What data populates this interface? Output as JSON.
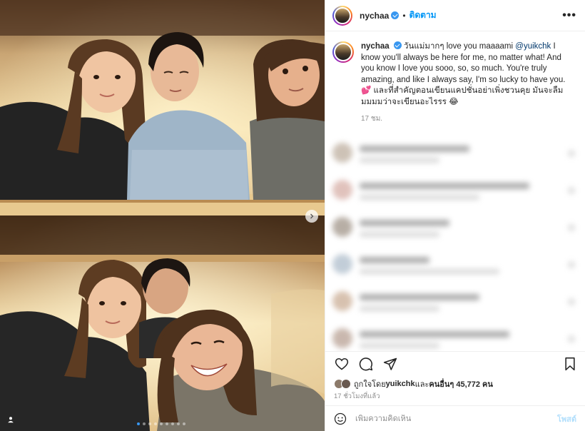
{
  "post": {
    "username": "nychaа",
    "follow_label": "ติดตาม",
    "more_label": "•••",
    "caption_username": "nychaа",
    "caption_part1": "วันแม่มากๆ love you maaaami ",
    "caption_mention": "@yuikchk",
    "caption_part2": " I know you'll always be here for me, no matter what! And you know I love you sooo, so, so much. You're truly amazing, and like I always say, I'm so lucky to have you. ",
    "caption_part3": " และที่สำคัญตอนเขียนแคปชั่นอย่าเพิ่งชวนคุย มันจะลืมมมมมว่าจะเขียนอะไรรร ",
    "caption_emoji_heart": "💕",
    "caption_emoji_laugh": "😂",
    "caption_time": "17 ชม.",
    "liked_by_prefix": "ถูกใจโดย ",
    "liked_by_user": "yuikchk",
    "liked_by_mid": " และ",
    "liked_by_others": "คนอื่นๆ 45,772 คน",
    "posted_ago": "17 ชั่วโมงที่แล้ว",
    "comment_placeholder": "เพิ่มความคิดเห็น",
    "post_button": "โพสต์"
  },
  "carousel": {
    "current_index": 1,
    "total": 9
  },
  "icons": [
    "more-icon",
    "heart-icon",
    "comment-icon",
    "share-icon",
    "bookmark-icon",
    "emoji-icon",
    "next-arrow-icon",
    "user-tag-icon",
    "verified-icon"
  ],
  "colors": {
    "accent": "#0095f6",
    "post_disabled": "#b2dffc",
    "verified": "#3897f0"
  }
}
